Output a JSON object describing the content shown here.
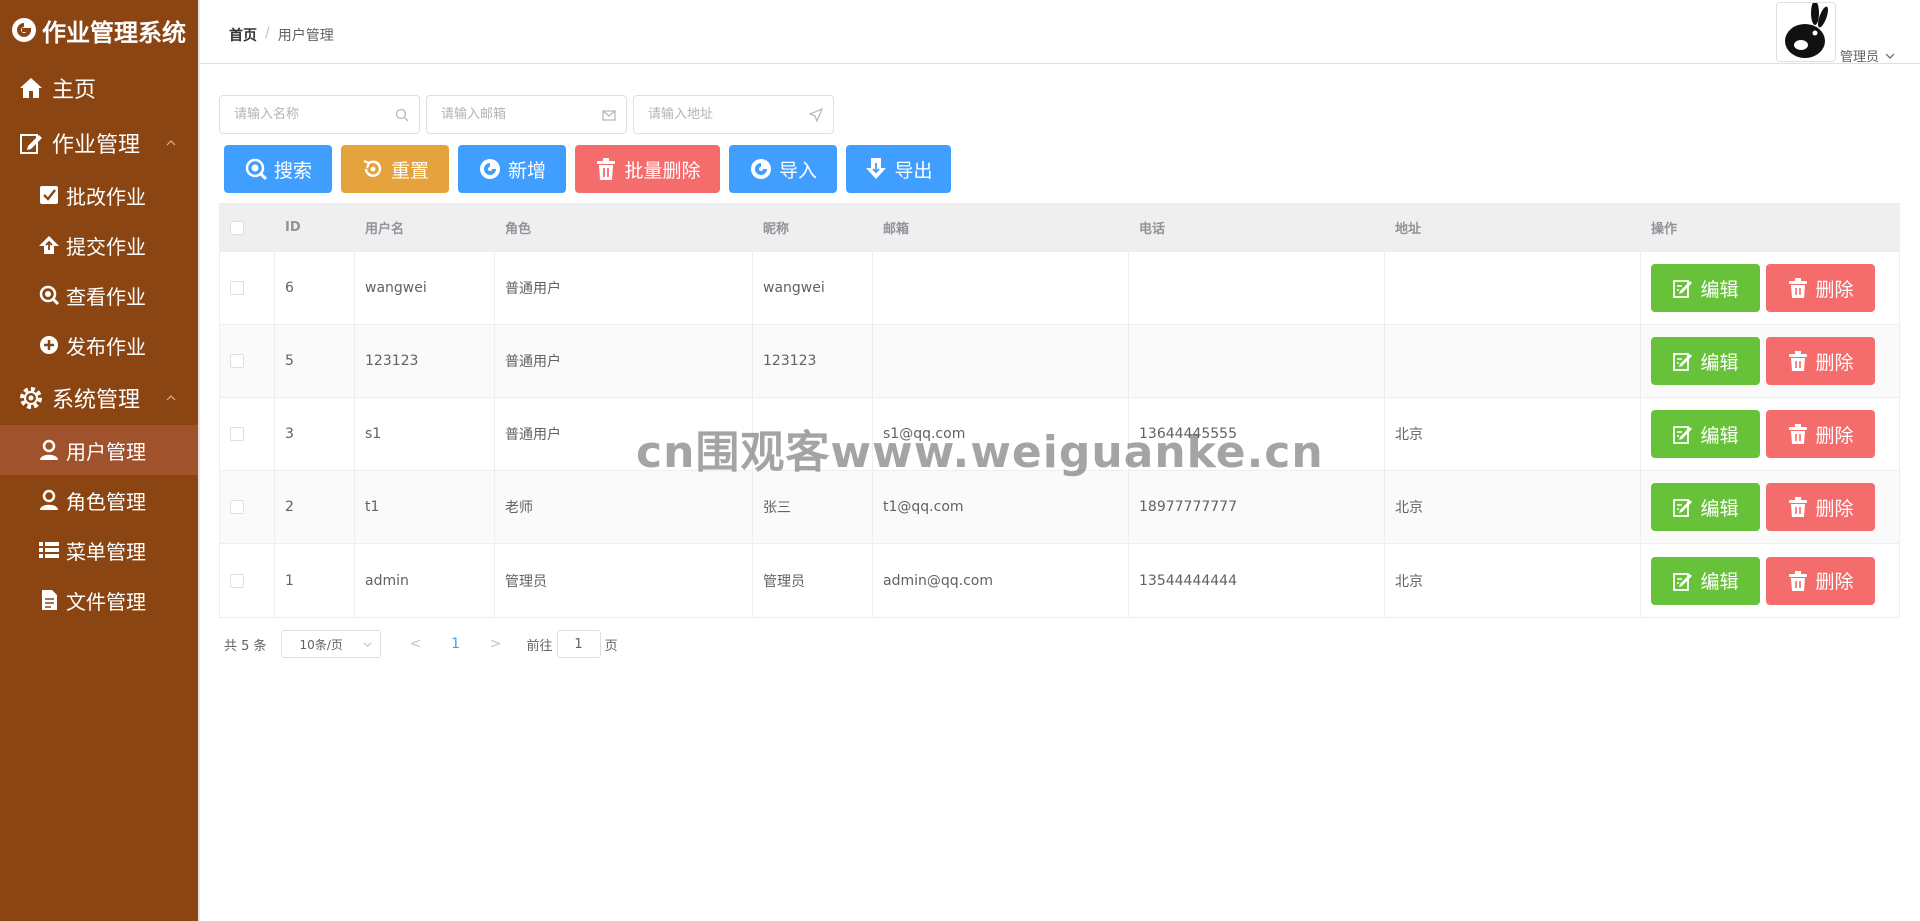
{
  "app": {
    "title": "作业管理系统"
  },
  "sidebar": {
    "items": [
      {
        "label": "主页",
        "icon": "home-icon"
      },
      {
        "label": "作业管理",
        "icon": "edit-icon"
      },
      {
        "label": "批改作业",
        "icon": "check-square-icon"
      },
      {
        "label": "提交作业",
        "icon": "upload-icon"
      },
      {
        "label": "查看作业",
        "icon": "search-icon"
      },
      {
        "label": "发布作业",
        "icon": "plus-circle-icon"
      },
      {
        "label": "系统管理",
        "icon": "gear-icon"
      },
      {
        "label": "用户管理",
        "icon": "user-icon"
      },
      {
        "label": "角色管理",
        "icon": "user-icon"
      },
      {
        "label": "菜单管理",
        "icon": "list-icon"
      },
      {
        "label": "文件管理",
        "icon": "document-icon"
      }
    ]
  },
  "header": {
    "breadcrumb": {
      "home": "首页",
      "sep": "/",
      "current": "用户管理"
    },
    "user": "管理员"
  },
  "search": {
    "name_placeholder": "请输入名称",
    "email_placeholder": "请输入邮箱",
    "address_placeholder": "请输入地址"
  },
  "toolbar": {
    "search": "搜索",
    "reset": "重置",
    "add": "新增",
    "batch_delete": "批量删除",
    "import": "导入",
    "export": "导出"
  },
  "table": {
    "headers": {
      "id": "ID",
      "username": "用户名",
      "role": "角色",
      "nickname": "昵称",
      "email": "邮箱",
      "phone": "电话",
      "address": "地址",
      "ops": "操作"
    },
    "edit_label": "编辑",
    "delete_label": "删除",
    "rows": [
      {
        "id": "6",
        "username": "wangwei",
        "role": "普通用户",
        "nickname": "wangwei",
        "email": "",
        "phone": "",
        "address": ""
      },
      {
        "id": "5",
        "username": "123123",
        "role": "普通用户",
        "nickname": "123123",
        "email": "",
        "phone": "",
        "address": ""
      },
      {
        "id": "3",
        "username": "s1",
        "role": "普通用户",
        "nickname": "",
        "email": "s1@qq.com",
        "phone": "13644445555",
        "address": "北京"
      },
      {
        "id": "2",
        "username": "t1",
        "role": "老师",
        "nickname": "张三",
        "email": "t1@qq.com",
        "phone": "18977777777",
        "address": "北京"
      },
      {
        "id": "1",
        "username": "admin",
        "role": "管理员",
        "nickname": "管理员",
        "email": "admin@qq.com",
        "phone": "13544444444",
        "address": "北京"
      }
    ]
  },
  "pagination": {
    "total": "共 5 条",
    "page_size": "10条/页",
    "prev": "<",
    "current": "1",
    "next": ">",
    "goto_prefix": "前往",
    "goto_value": "1",
    "goto_suffix": "页"
  },
  "watermark": "cn围观客www.weiguanke.cn",
  "colors": {
    "sidebar": "#8b4513",
    "sidebar_active": "#a0522d",
    "primary": "#409eff",
    "warning": "#e6a23c",
    "danger": "#f56c6c",
    "success": "#67c23a"
  }
}
